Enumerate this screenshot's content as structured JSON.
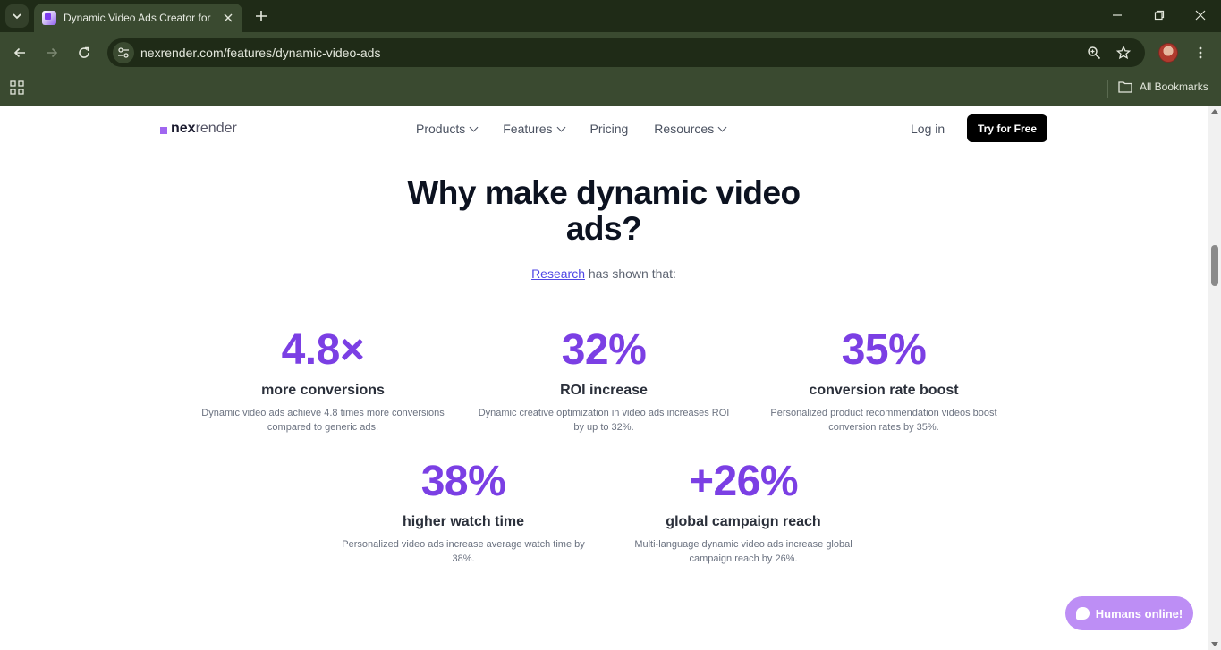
{
  "browser": {
    "tab_title": "Dynamic Video Ads Creator for",
    "url": "nexrender.com/features/dynamic-video-ads",
    "bookmarks_label": "All Bookmarks"
  },
  "site": {
    "logo_bold": "nex",
    "logo_light": "render",
    "nav": [
      "Products",
      "Features",
      "Pricing",
      "Resources"
    ],
    "login_label": "Log in",
    "cta_label": "Try for Free"
  },
  "content": {
    "headline": "Why make dynamic video ads?",
    "sub_link": "Research",
    "sub_rest": " has shown that:",
    "stats": [
      {
        "value": "4.8×",
        "label": "more conversions",
        "desc": "Dynamic video ads achieve 4.8 times more conversions compared to generic ads."
      },
      {
        "value": "32%",
        "label": "ROI increase",
        "desc": "Dynamic creative optimization in video ads increases ROI by up to 32%."
      },
      {
        "value": "35%",
        "label": "conversion rate boost",
        "desc": "Personalized product recommendation videos boost conversion rates by 35%."
      },
      {
        "value": "38%",
        "label": "higher watch time",
        "desc": "Personalized video ads increase average watch time by 38%."
      },
      {
        "value": "+26%",
        "label": "global campaign reach",
        "desc": "Multi-language dynamic video ads increase global campaign reach by 26%."
      }
    ]
  },
  "chat": {
    "label": "Humans online!"
  },
  "colors": {
    "accent": "#7b3fe4",
    "chrome": "#3a4a30",
    "chrome_dark": "#1f2b17"
  }
}
